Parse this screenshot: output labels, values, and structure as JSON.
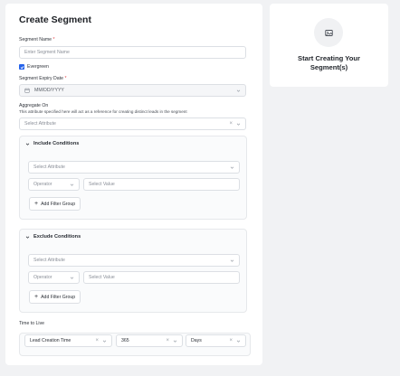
{
  "form": {
    "title": "Create Segment",
    "segment_name": {
      "label": "Segment Name",
      "required_mark": "*",
      "placeholder": "Enter Segment Name"
    },
    "evergreen": {
      "label": "Evergreen",
      "checked": true
    },
    "expiry": {
      "label": "Segment Expiry Date",
      "required_mark": "*",
      "placeholder": "MM/DD/YYYY"
    },
    "aggregate": {
      "label": "Aggregate On",
      "help": "This attribute specified here will act as a reference for creating distinct leads in the segment",
      "placeholder": "Select Attribute"
    },
    "include": {
      "title": "Include Conditions",
      "attribute_placeholder": "Select Attribute",
      "operator_placeholder": "Operator",
      "value_placeholder": "Select Value",
      "add_button": "Add Filter Group"
    },
    "exclude": {
      "title": "Exclude Conditions",
      "attribute_placeholder": "Select Attribute",
      "operator_placeholder": "Operator",
      "value_placeholder": "Select Value",
      "add_button": "Add Filter Group"
    },
    "ttl": {
      "label": "Time to Live",
      "field": "Lead Creation Time",
      "amount": "365",
      "unit": "Days"
    }
  },
  "side_panel": {
    "text": "Start Creating Your Segment(s)",
    "icon": "image-placeholder-icon"
  },
  "colors": {
    "accent": "#2563eb",
    "required": "#e5484d",
    "background": "#f1f2f4"
  }
}
